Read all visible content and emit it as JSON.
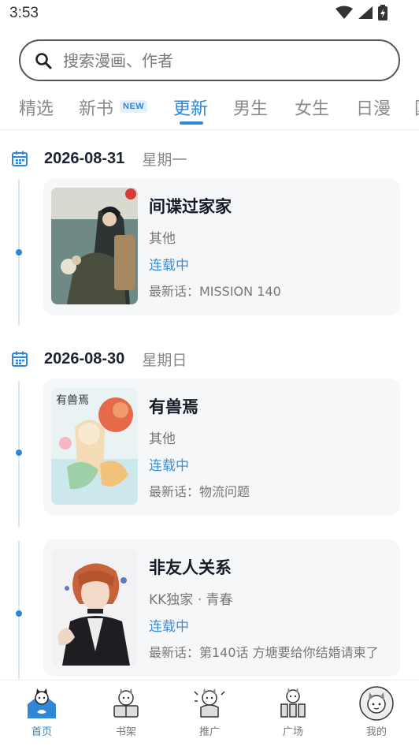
{
  "status_bar": {
    "time": "3:53"
  },
  "search": {
    "placeholder": "搜索漫画、作者"
  },
  "tabs": [
    {
      "label": "精选"
    },
    {
      "label": "新书",
      "badge": "NEW"
    },
    {
      "label": "更新",
      "active": true
    },
    {
      "label": "男生"
    },
    {
      "label": "女生"
    },
    {
      "label": "日漫"
    },
    {
      "label": "国"
    }
  ],
  "updates": [
    {
      "date": "2026-08-31",
      "weekday": "星期一",
      "title": "间谍过家家",
      "genre": "其他",
      "status": "连载中",
      "latest": "最新话：MISSION 140"
    },
    {
      "date": "2026-08-30",
      "weekday": "星期日",
      "title": "有兽焉",
      "genre": "其他",
      "status": "连载中",
      "latest": "最新话：物流问题"
    },
    {
      "date": "",
      "weekday": "",
      "title": "非友人关系",
      "genre": "KK独家 · 青春",
      "status": "连载中",
      "latest": "最新话：第140话 方塘要给你结婚请柬了"
    }
  ],
  "bottom_nav": [
    {
      "label": "首页",
      "active": true
    },
    {
      "label": "书架"
    },
    {
      "label": "推广"
    },
    {
      "label": "广场"
    },
    {
      "label": "我的"
    }
  ],
  "colors": {
    "accent": "#2f87d6",
    "status_blue": "#3b8fd8",
    "card_bg": "#f6f7f9"
  }
}
